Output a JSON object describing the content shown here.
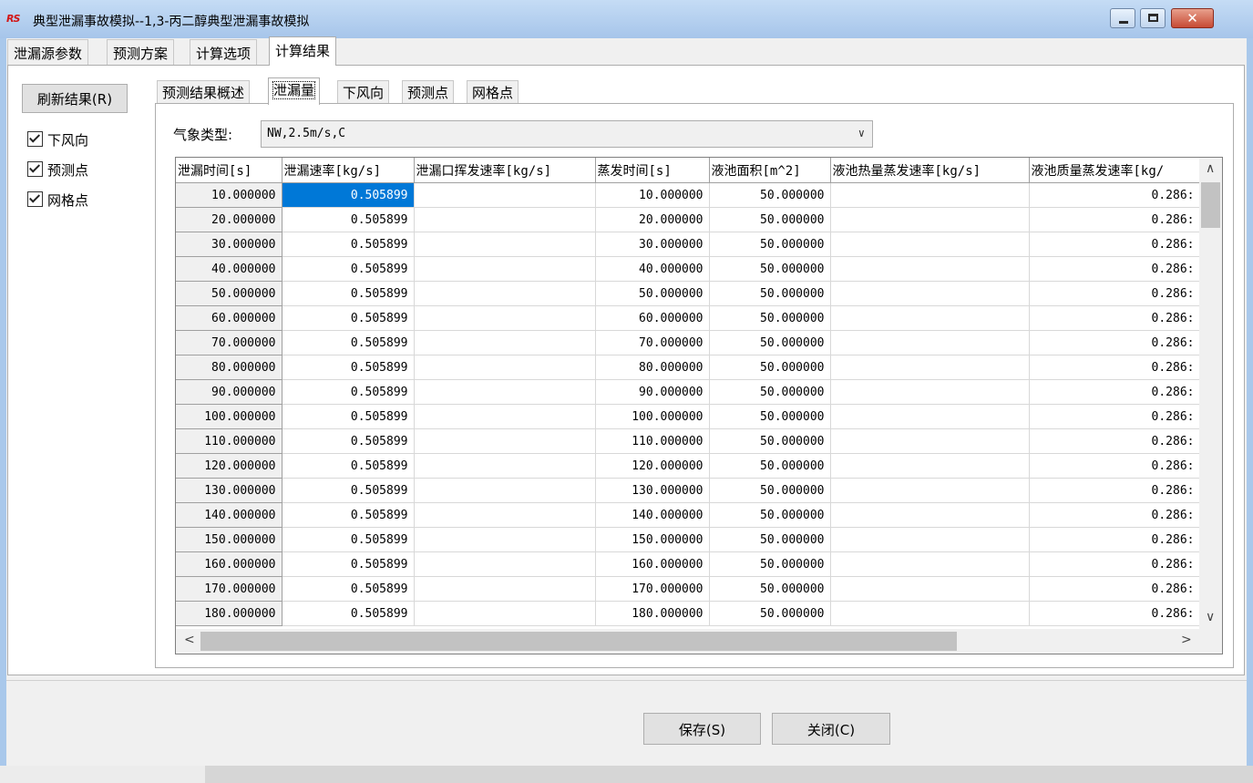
{
  "window": {
    "title": "典型泄漏事故模拟--1,3-丙二醇典型泄漏事故模拟",
    "app_icon_text": "RS",
    "close_symbol": "✕"
  },
  "outer_tabs": [
    "泄漏源参数",
    "预测方案",
    "计算选项",
    "计算结果"
  ],
  "left_panel": {
    "refresh_label": "刷新结果(R)",
    "checkboxes": [
      {
        "label": "下风向",
        "checked": true
      },
      {
        "label": "预测点",
        "checked": true
      },
      {
        "label": "网格点",
        "checked": true
      }
    ]
  },
  "inner_tabs": [
    "预测结果概述",
    "泄漏量",
    "下风向",
    "预测点",
    "网格点"
  ],
  "weather": {
    "label": "气象类型:",
    "value": "NW,2.5m/s,C"
  },
  "table": {
    "columns": [
      "泄漏时间[s]",
      "泄漏速率[kg/s]",
      "泄漏口挥发速率[kg/s]",
      "蒸发时间[s]",
      "液池面积[m^2]",
      "液池热量蒸发速率[kg/s]",
      "液池质量蒸发速率[kg/"
    ],
    "rows": [
      [
        "10.000000",
        "0.505899",
        "",
        "10.000000",
        "50.000000",
        "",
        "0.286:"
      ],
      [
        "20.000000",
        "0.505899",
        "",
        "20.000000",
        "50.000000",
        "",
        "0.286:"
      ],
      [
        "30.000000",
        "0.505899",
        "",
        "30.000000",
        "50.000000",
        "",
        "0.286:"
      ],
      [
        "40.000000",
        "0.505899",
        "",
        "40.000000",
        "50.000000",
        "",
        "0.286:"
      ],
      [
        "50.000000",
        "0.505899",
        "",
        "50.000000",
        "50.000000",
        "",
        "0.286:"
      ],
      [
        "60.000000",
        "0.505899",
        "",
        "60.000000",
        "50.000000",
        "",
        "0.286:"
      ],
      [
        "70.000000",
        "0.505899",
        "",
        "70.000000",
        "50.000000",
        "",
        "0.286:"
      ],
      [
        "80.000000",
        "0.505899",
        "",
        "80.000000",
        "50.000000",
        "",
        "0.286:"
      ],
      [
        "90.000000",
        "0.505899",
        "",
        "90.000000",
        "50.000000",
        "",
        "0.286:"
      ],
      [
        "100.000000",
        "0.505899",
        "",
        "100.000000",
        "50.000000",
        "",
        "0.286:"
      ],
      [
        "110.000000",
        "0.505899",
        "",
        "110.000000",
        "50.000000",
        "",
        "0.286:"
      ],
      [
        "120.000000",
        "0.505899",
        "",
        "120.000000",
        "50.000000",
        "",
        "0.286:"
      ],
      [
        "130.000000",
        "0.505899",
        "",
        "130.000000",
        "50.000000",
        "",
        "0.286:"
      ],
      [
        "140.000000",
        "0.505899",
        "",
        "140.000000",
        "50.000000",
        "",
        "0.286:"
      ],
      [
        "150.000000",
        "0.505899",
        "",
        "150.000000",
        "50.000000",
        "",
        "0.286:"
      ],
      [
        "160.000000",
        "0.505899",
        "",
        "160.000000",
        "50.000000",
        "",
        "0.286:"
      ],
      [
        "170.000000",
        "0.505899",
        "",
        "170.000000",
        "50.000000",
        "",
        "0.286:"
      ],
      [
        "180.000000",
        "0.505899",
        "",
        "180.000000",
        "50.000000",
        "",
        "0.286:"
      ]
    ]
  },
  "scroll_arrows": {
    "up": "∧",
    "down": "∨",
    "left": "<",
    "right": ">"
  },
  "footer": {
    "save_label": "保存(S)",
    "close_label": "关闭(C)"
  }
}
